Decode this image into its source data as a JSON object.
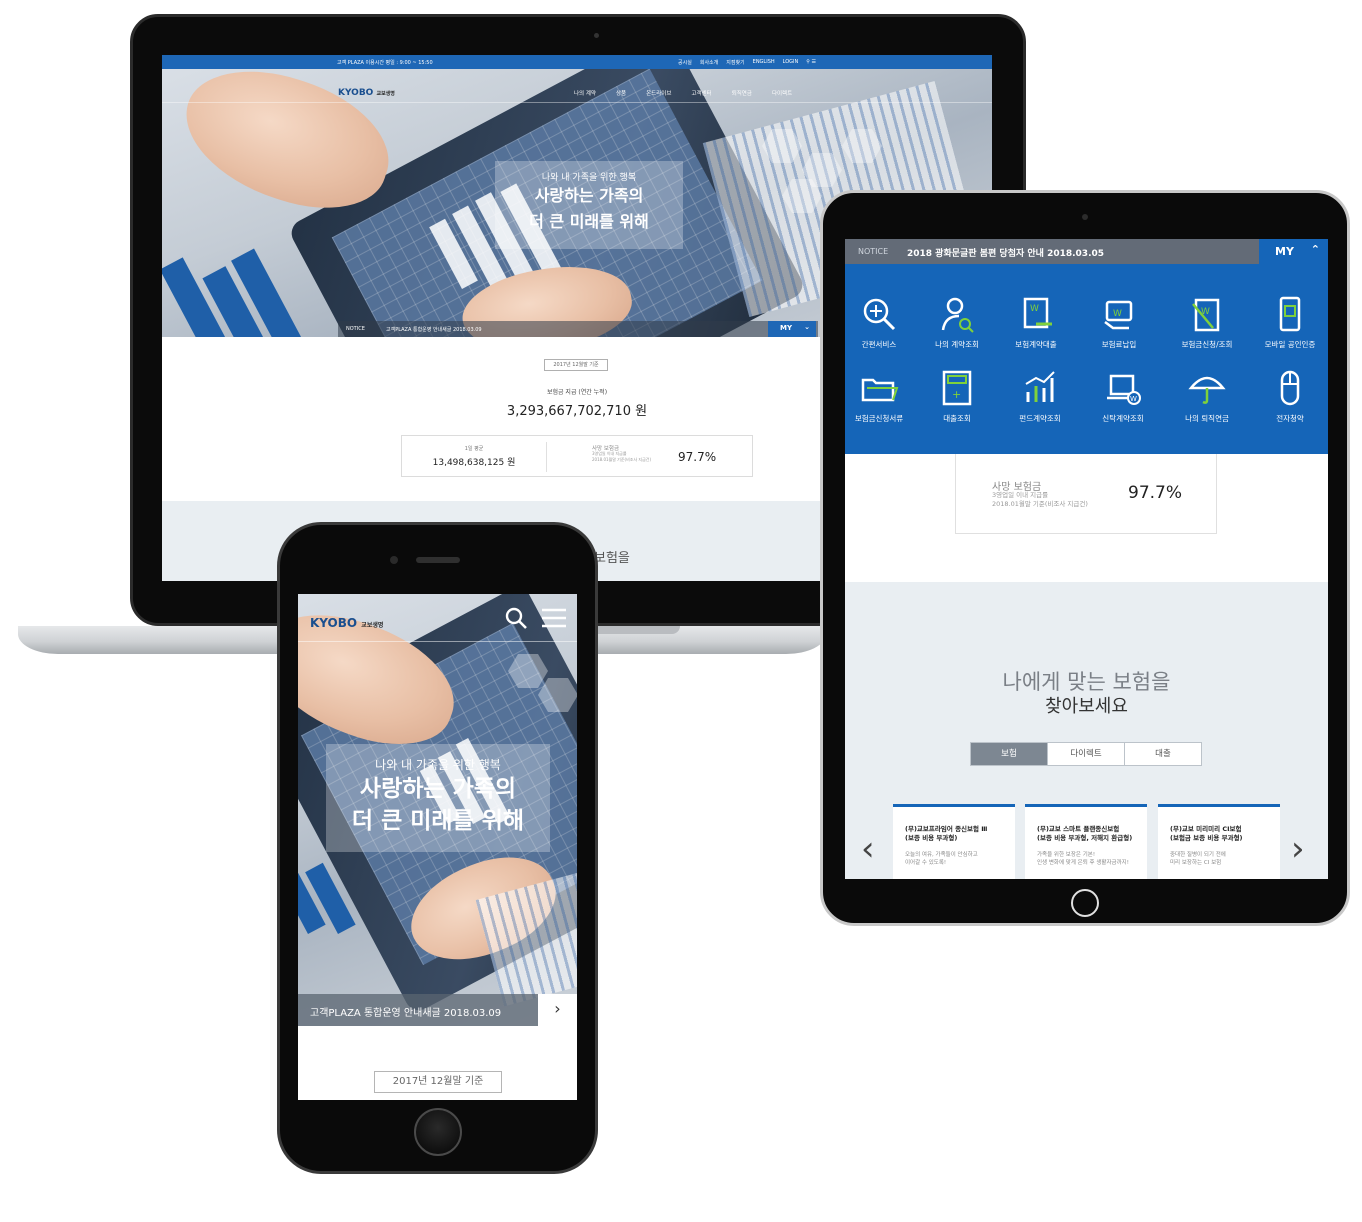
{
  "laptop": {
    "topbar": {
      "hours": "고객 PLAZA 이용시간 평일 : 9:00 ~ 15:50",
      "links": [
        "공시실",
        "회사소개",
        "지점찾기",
        "ENGLISH",
        "LOGIN"
      ]
    },
    "logo": {
      "name": "KYOBO",
      "sub": "교보생명"
    },
    "menu": [
      "나의 계약",
      "상품",
      "온드라이브",
      "고객센터",
      "퇴직연금",
      "다이렉트"
    ],
    "hero": {
      "small": "나와 내 가족을 위한 행복",
      "line1": "사랑하는 가족의",
      "line2": "더 큰 미래를 위해"
    },
    "notice": {
      "label": "NOTICE",
      "text": "고객PLAZA 통합운영 안내새글  2018.03.09"
    },
    "my_label": "MY",
    "stats": {
      "basis": "2017년 12월말 기준",
      "paid_label": "보험금 지급 (연간 누적)",
      "paid_amount": "3,293,667,702,710 원",
      "avg_label": "1일 평균",
      "avg_value": "13,498,638,125 원",
      "rate_label": "사망 보험금",
      "rate_note1": "3영업일 이내 지급률",
      "rate_note2": "2018.01월말 기준(비조사 지급건)",
      "rate_value": "97.7%"
    },
    "find_text": "보험을"
  },
  "tablet": {
    "notice": {
      "label": "NOTICE",
      "text": "2018 광화문글판 봄편 당첨자 안내    2018.03.05"
    },
    "my_label": "MY",
    "services": [
      {
        "label": "간편서비스",
        "icon": "magnifier-plus-icon"
      },
      {
        "label": "나의 계약조회",
        "icon": "person-search-icon"
      },
      {
        "label": "보험계약대출",
        "icon": "document-won-icon"
      },
      {
        "label": "보험료납입",
        "icon": "hand-card-icon"
      },
      {
        "label": "보험금신청/조회",
        "icon": "clipboard-icon"
      },
      {
        "label": "모바일 공인인증",
        "icon": "mobile-icon"
      },
      {
        "label": "보험금신청서류",
        "icon": "folder-icon"
      },
      {
        "label": "대출조회",
        "icon": "calculator-icon"
      },
      {
        "label": "펀드계약조회",
        "icon": "chart-icon"
      },
      {
        "label": "신탁계약조회",
        "icon": "laptop-won-icon"
      },
      {
        "label": "나의 퇴직연금",
        "icon": "umbrella-icon"
      },
      {
        "label": "전자청약",
        "icon": "mouse-icon"
      }
    ],
    "stats": {
      "rate_label": "사망 보험금",
      "rate_note1": "3영업일 이내 지급률",
      "rate_note2": "2018.01월말 기준(비조사 지급건)",
      "rate_value": "97.7%"
    },
    "find": {
      "line1": "나에게 맞는 보험을",
      "line2": "찾아보세요",
      "tabs": [
        "보험",
        "다이렉트",
        "대출"
      ],
      "cards": [
        {
          "title1": "(무)교보프라임어 종신보험 Ⅲ",
          "title2": "(보증 비용 부과형)",
          "desc1": "오늘의 여유, 가족들이 안심하고",
          "desc2": "이어갈 수 있도록!"
        },
        {
          "title1": "(무)교보 스마트 플랜종신보험",
          "title2": "(보증 비용 부과형, 저해지 환급형)",
          "desc1": "가족을 위한 보장은 기본!",
          "desc2": "인생 변화에 맞게 은퇴 후 생활자금까지!"
        },
        {
          "title1": "(무)교보 미리미리 CI보험",
          "title2": "(보험금 보증 비용 부과형)",
          "desc1": "중대한 질병이 되기 전에",
          "desc2": "미리 보장하는 CI 보험"
        }
      ]
    }
  },
  "phone": {
    "logo": {
      "name": "KYOBO",
      "sub": "교보생명"
    },
    "hero": {
      "small": "나와 내 가족을 위한 행복",
      "line1": "사랑하는 가족의",
      "line2": "더 큰 미래를 위해"
    },
    "notice": "고객PLAZA 통합운영 안내새글  2018.03.09",
    "basis": "2017년 12월말 기준"
  },
  "colors": {
    "brand_blue": "#1565b8",
    "panel_gray": "#e9eef2",
    "device_black": "#0a0a0a"
  }
}
